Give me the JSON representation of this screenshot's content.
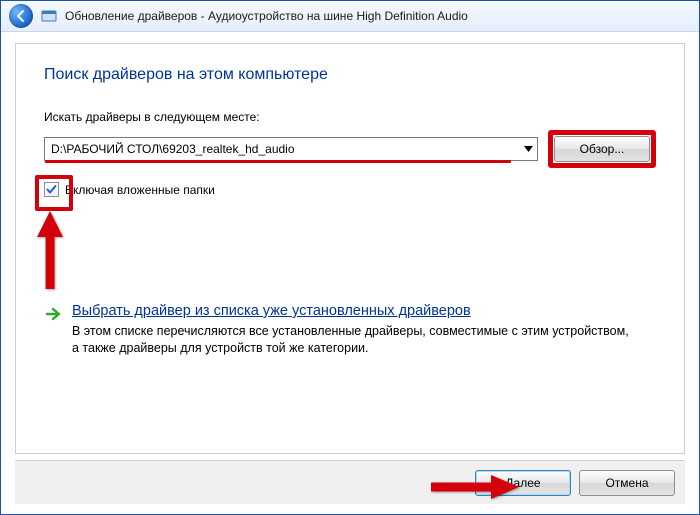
{
  "window": {
    "title": "Обновление драйверов - Аудиоустройство на шине High Definition Audio"
  },
  "heading": "Поиск драйверов на этом компьютере",
  "search_label": "Искать драйверы в следующем месте:",
  "path_value": "D:\\РАБОЧИЙ СТОЛ\\69203_realtek_hd_audio",
  "browse_label": "Обзор...",
  "include_sub_label": "Включая вложенные папки",
  "include_sub_checked": true,
  "option": {
    "title": "Выбрать драйвер из списка уже установленных драйверов",
    "desc": "В этом списке перечисляются все установленные драйверы, совместимые с этим устройством, а также драйверы для устройств той же категории."
  },
  "footer": {
    "next": "Далее",
    "cancel": "Отмена"
  }
}
